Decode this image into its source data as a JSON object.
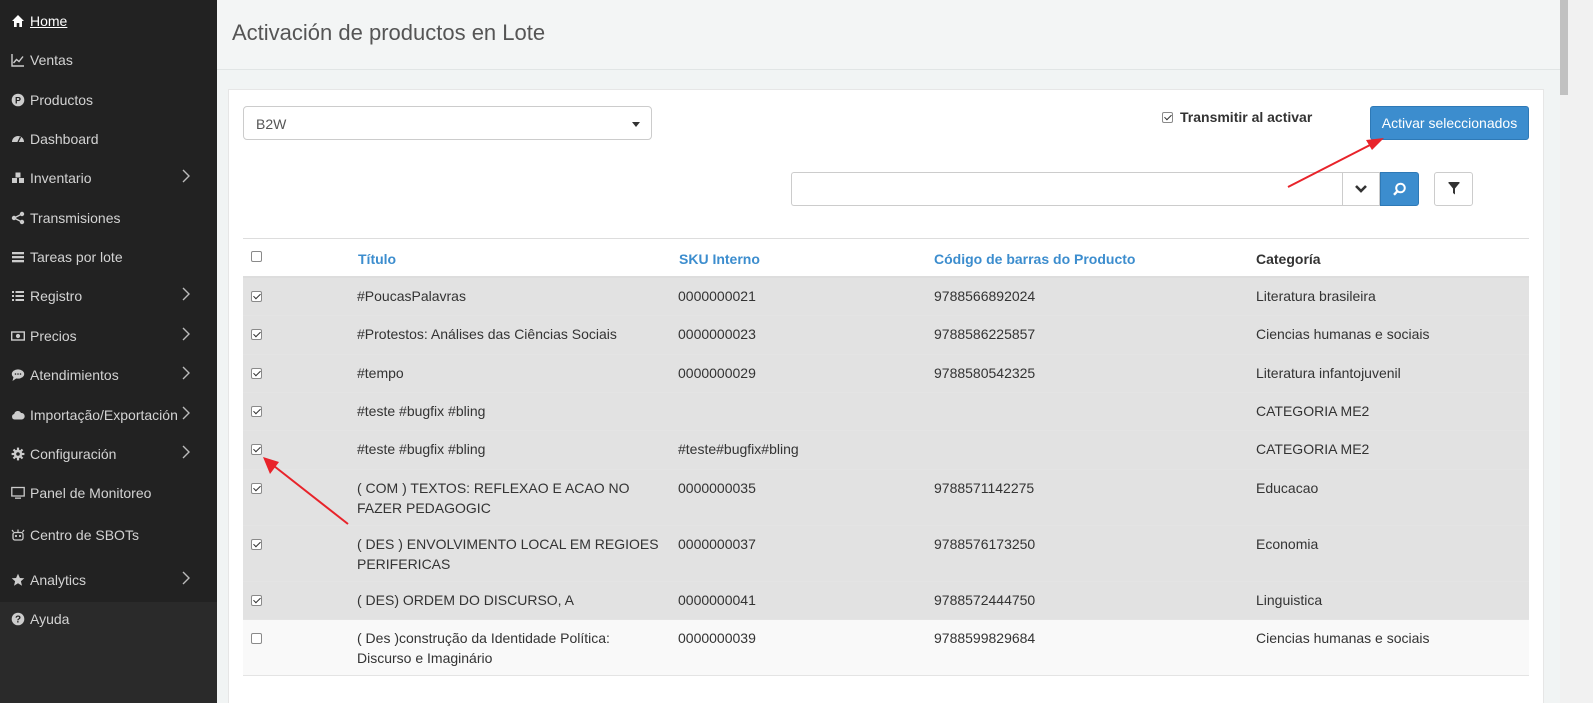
{
  "sidebar": {
    "items": [
      {
        "label": "Home",
        "icon": "home-icon",
        "has_submenu": false,
        "active": true
      },
      {
        "label": "Ventas",
        "icon": "line-chart-icon",
        "has_submenu": false
      },
      {
        "label": "Productos",
        "icon": "product-p-icon",
        "has_submenu": false
      },
      {
        "label": "Dashboard",
        "icon": "dashboard-gauge-icon",
        "has_submenu": false
      },
      {
        "label": "Inventario",
        "icon": "cubes-icon",
        "has_submenu": true
      },
      {
        "label": "Transmisiones",
        "icon": "share-nodes-icon",
        "has_submenu": false
      },
      {
        "label": "Tareas por lote",
        "icon": "tasks-list-icon",
        "has_submenu": false
      },
      {
        "label": "Registro",
        "icon": "list-icon",
        "has_submenu": true
      },
      {
        "label": "Precios",
        "icon": "money-icon",
        "has_submenu": true
      },
      {
        "label": "Atendimientos",
        "icon": "chat-bubble-icon",
        "has_submenu": true
      },
      {
        "label": "Importação/Exportación",
        "icon": "cloud-icon",
        "has_submenu": true
      },
      {
        "label": "Configuración",
        "icon": "gear-icon",
        "has_submenu": true
      },
      {
        "label": "Panel de Monitoreo",
        "icon": "monitor-icon",
        "has_submenu": false
      },
      {
        "label": "Centro de SBOTs",
        "icon": "robot-icon",
        "has_submenu": false
      },
      {
        "label": "Analytics",
        "icon": "star-icon",
        "has_submenu": true
      },
      {
        "label": "Ayuda",
        "icon": "help-circle-icon",
        "has_submenu": false
      }
    ]
  },
  "header": {
    "title": "Activación de productos en Lote"
  },
  "toolbar": {
    "marketplace_selected": "B2W",
    "transmit_label": "Transmitir al activar",
    "transmit_checked": true,
    "activate_label": "Activar seleccionados",
    "search_value": ""
  },
  "table": {
    "columns": [
      "Título",
      "SKU Interno",
      "Código de barras do Producto",
      "Categoría"
    ],
    "rows": [
      {
        "checked": true,
        "title": [
          "#PoucasPalavras"
        ],
        "sku": "0000000021",
        "barcode": "9788566892024",
        "category": "Literatura brasileira"
      },
      {
        "checked": true,
        "title": [
          "#Protestos: Análises das Ciências Sociais"
        ],
        "sku": "0000000023",
        "barcode": "9788586225857",
        "category": "Ciencias humanas e sociais"
      },
      {
        "checked": true,
        "title": [
          "#tempo"
        ],
        "sku": "0000000029",
        "barcode": "9788580542325",
        "category": "Literatura infantojuvenil"
      },
      {
        "checked": true,
        "title": [
          "#teste #bugfix #bling"
        ],
        "sku": "",
        "barcode": "",
        "category": "CATEGORIA ME2"
      },
      {
        "checked": true,
        "title": [
          "#teste #bugfix #bling"
        ],
        "sku": "#teste#bugfix#bling",
        "barcode": "",
        "category": "CATEGORIA ME2"
      },
      {
        "checked": true,
        "title": [
          "( COM ) TEXTOS: REFLEXAO E ACAO NO",
          "FAZER PEDAGOGIC"
        ],
        "sku": "0000000035",
        "barcode": "9788571142275",
        "category": "Educacao"
      },
      {
        "checked": true,
        "title": [
          "( DES ) ENVOLVIMENTO LOCAL EM REGIOES",
          "PERIFERICAS"
        ],
        "sku": "0000000037",
        "barcode": "9788576173250",
        "category": "Economia"
      },
      {
        "checked": true,
        "title": [
          "( DES) ORDEM DO DISCURSO, A"
        ],
        "sku": "0000000041",
        "barcode": "9788572444750",
        "category": "Linguistica"
      },
      {
        "checked": false,
        "title": [
          "( Des )construção da Identidade Política:",
          "Discurso e Imaginário"
        ],
        "sku": "0000000039",
        "barcode": "9788599829684",
        "category": "Ciencias humanas e sociais"
      }
    ]
  },
  "annotations": {
    "arrow_color": "#e8232a"
  },
  "colors": {
    "accent": "#3c8dce",
    "sidebar_bg": "#222222",
    "selected_row": "#e2e2e2"
  }
}
